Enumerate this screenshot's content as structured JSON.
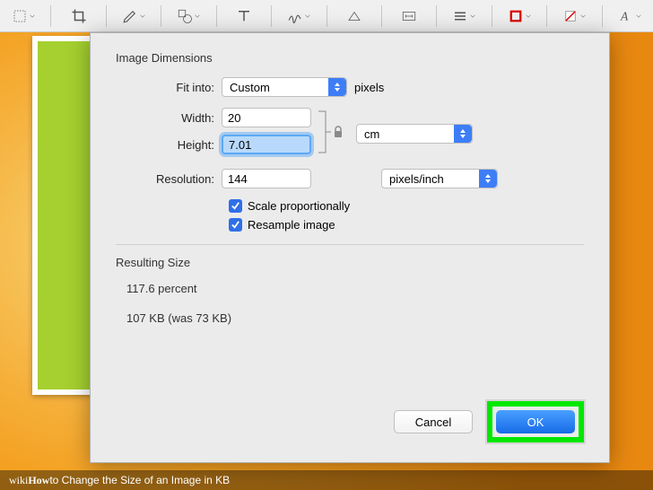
{
  "dialog": {
    "section1_title": "Image Dimensions",
    "fit_into_label": "Fit into:",
    "fit_into_value": "Custom",
    "fit_into_unit": "pixels",
    "width_label": "Width:",
    "width_value": "20",
    "height_label": "Height:",
    "height_value": "7.01",
    "wh_unit": "cm",
    "resolution_label": "Resolution:",
    "resolution_value": "144",
    "resolution_unit": "pixels/inch",
    "scale_label": "Scale proportionally",
    "resample_label": "Resample image",
    "scale_checked": true,
    "resample_checked": true,
    "section2_title": "Resulting Size",
    "percent_line": "117.6 percent",
    "size_line": "107 KB (was 73 KB)",
    "cancel": "Cancel",
    "ok": "OK"
  },
  "footer": {
    "brand1": "wiki",
    "brand2": "How",
    "title": " to Change the Size of an Image in KB"
  }
}
